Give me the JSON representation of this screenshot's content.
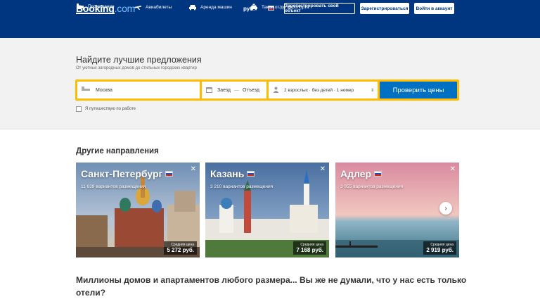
{
  "header": {
    "logo_main": "Booking",
    "logo_suffix": ".com",
    "currency": "руб.",
    "flag_icon": "russia-flag-icon",
    "list_property": "Зарегистрировать свой объект",
    "register": "Зарегистрироваться",
    "login": "Войти в аккаунт"
  },
  "nav": {
    "items": [
      {
        "label": "Проживание",
        "icon": "bed-icon",
        "active": true
      },
      {
        "label": "Авиабилеты",
        "icon": "plane-icon",
        "active": false
      },
      {
        "label": "Аренда машин",
        "icon": "car-icon",
        "active": false
      },
      {
        "label": "Такси от/до аэропорта",
        "icon": "taxi-icon",
        "active": false
      }
    ]
  },
  "search": {
    "title": "Найдите лучшие предложения",
    "subtitle": "От уютных загородных домов до стильных городских квартир",
    "destination_value": "Москва",
    "checkin": "Заезд",
    "dates_sep": "—",
    "checkout": "Отъезд",
    "guests": "2 взрослых · без детей · 1 номер",
    "button": "Проверить цены",
    "work_trip": "Я путешествую по работе"
  },
  "destinations": {
    "title": "Другие направления",
    "price_label": "Средняя цена",
    "cards": [
      {
        "city": "Санкт-Петербург",
        "count": "11 639 вариантов размещения",
        "price": "5 272 руб."
      },
      {
        "city": "Казань",
        "count": "3 210 вариантов размещения",
        "price": "7 168 руб."
      },
      {
        "city": "Адлер",
        "count": "3 955 вариантов размещения",
        "price": "2 919 руб."
      }
    ]
  },
  "promo": {
    "heading": "Миллионы домов и апартаментов любого размера... Вы же не думали, что у нас есть только отели?"
  },
  "colors": {
    "brand": "#003580",
    "accent": "#febb02",
    "button": "#0071c2"
  }
}
